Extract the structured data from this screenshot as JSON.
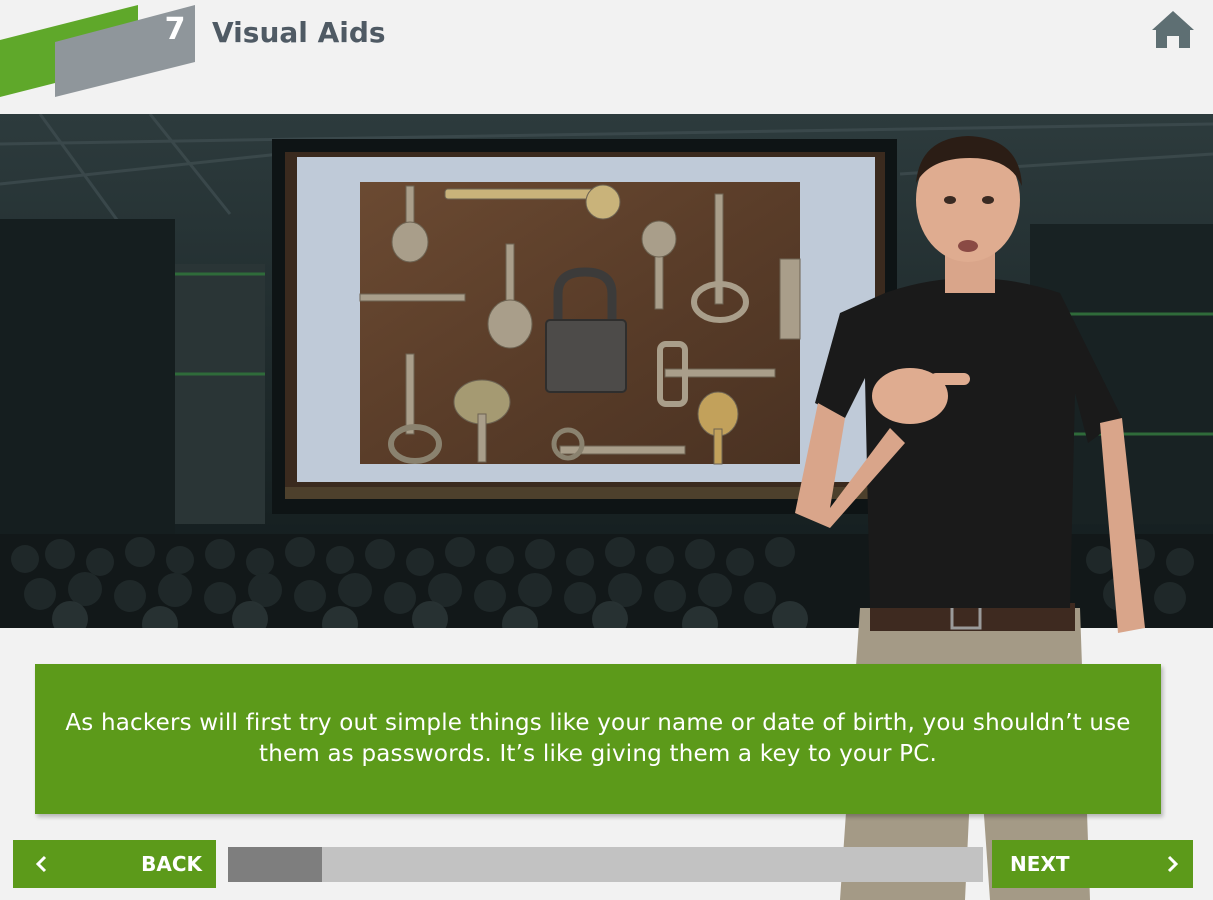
{
  "header": {
    "lesson_number": "7",
    "title": "Visual Aids",
    "home_icon": "home-icon"
  },
  "caption": {
    "text": "As hackers will first try out simple things like your name or date of birth, you shouldn’t use them as passwords. It’s like giving them a key to your PC."
  },
  "navigation": {
    "back_label": "BACK",
    "next_label": "NEXT",
    "back_icon": "chevron-left-icon",
    "next_icon": "chevron-right-icon",
    "progress": 0.125
  },
  "colors": {
    "accent_green": "#5c9a1a",
    "header_gray": "#4f5a64",
    "progress_track": "#c2c2c2",
    "progress_fill": "#7e7e7e"
  }
}
